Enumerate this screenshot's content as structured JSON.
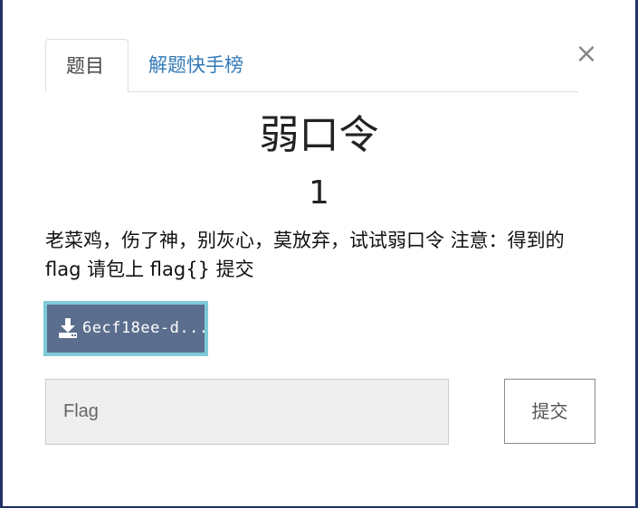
{
  "tabs": {
    "challenge_label": "题目",
    "leaderboard_label": "解题快手榜"
  },
  "close_symbol": "×",
  "challenge": {
    "name": "弱口令",
    "value": "1",
    "description": "老菜鸡，伤了神，别灰心，莫放弃，试试弱口令 注意：得到的flag 请包上 flag{} 提交"
  },
  "download": {
    "icon": "download-icon",
    "label": "6ecf18ee-d..."
  },
  "flag_input": {
    "placeholder": "Flag",
    "value": ""
  },
  "submit_label": "提交",
  "colors": {
    "backdrop": "#1f2f5e",
    "tab_link": "#337ab7",
    "download_bg": "#5b6e8e",
    "download_border": "#7ec9d8"
  }
}
